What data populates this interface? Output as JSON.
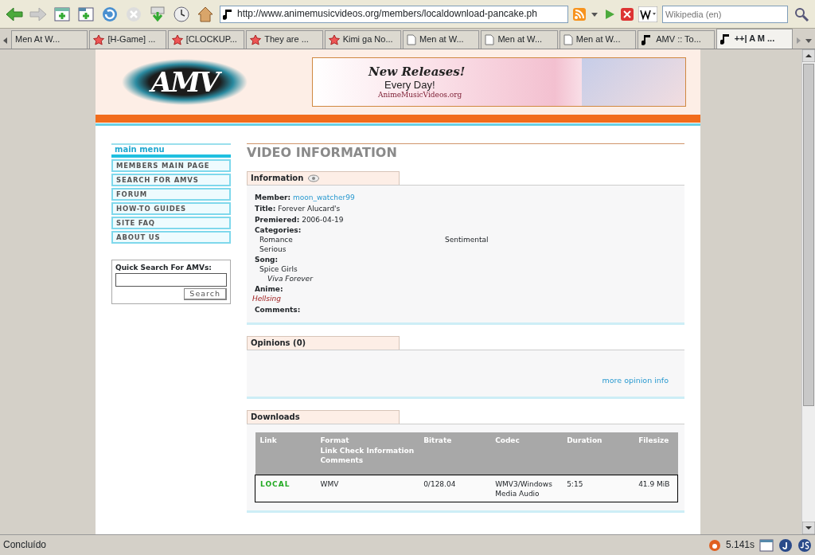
{
  "browser": {
    "url": "http://www.animemusicvideos.org/members/localdownload-pancake.ph",
    "search_placeholder": "Wikipedia (en)",
    "tabs": [
      {
        "label": "Men At W...",
        "kind": "plain",
        "selected": false
      },
      {
        "label": "[H-Game] ...",
        "kind": "star",
        "selected": false
      },
      {
        "label": "[CLOCKUP...",
        "kind": "star",
        "selected": false
      },
      {
        "label": "They are ...",
        "kind": "star",
        "selected": false
      },
      {
        "label": "Kimi ga No...",
        "kind": "star",
        "selected": false
      },
      {
        "label": "Men at W...",
        "kind": "page",
        "selected": false
      },
      {
        "label": "Men at W...",
        "kind": "page",
        "selected": false
      },
      {
        "label": "Men at W...",
        "kind": "page",
        "selected": false
      },
      {
        "label": "AMV :: To...",
        "kind": "note",
        "selected": false
      },
      {
        "label": "++| A M ...",
        "kind": "note",
        "selected": true
      }
    ]
  },
  "header": {
    "logo_text": "AMV",
    "banner": {
      "headline": "New Releases!",
      "subline": "Every Day!",
      "site": "AnimeMusicVideos.org"
    }
  },
  "sidebar": {
    "menu_title": "main menu",
    "items": [
      "MEMBERS MAIN PAGE",
      "SEARCH FOR AMVS",
      "FORUM",
      "HOW-TO GUIDES",
      "SITE FAQ",
      "ABOUT US"
    ],
    "quick_search": {
      "title": "Quick Search For AMVs:",
      "button": "Search"
    }
  },
  "page_title": "VIDEO INFORMATION",
  "information": {
    "heading": "Information",
    "member_label": "Member:",
    "member": "moon_watcher99",
    "title_label": "Title:",
    "title": "Forever Alucard's",
    "premiered_label": "Premiered:",
    "premiered": "2006-04-19",
    "categories_label": "Categories:",
    "categories": [
      "Romance",
      "Sentimental",
      "Serious"
    ],
    "song_label": "Song:",
    "artist": "Spice Girls",
    "song": "Viva Forever",
    "anime_label": "Anime:",
    "anime": "Hellsing",
    "comments_label": "Comments:"
  },
  "opinions": {
    "heading": "Opinions (0)",
    "link": "more opinion info"
  },
  "downloads": {
    "heading": "Downloads",
    "columns": [
      "Link",
      "Format",
      "Bitrate",
      "Codec",
      "Duration",
      "Filesize"
    ],
    "extra_headers": [
      "Link Check Information",
      "Comments"
    ],
    "rows": [
      {
        "link": "LOCAL",
        "format": "WMV",
        "bitrate": "0/128.04",
        "codec": "WMV3/Windows Media Audio",
        "duration": "5:15",
        "filesize": "41.9 MiB"
      }
    ]
  },
  "status_bar": {
    "text": "Concluído",
    "time": "5.141s"
  }
}
